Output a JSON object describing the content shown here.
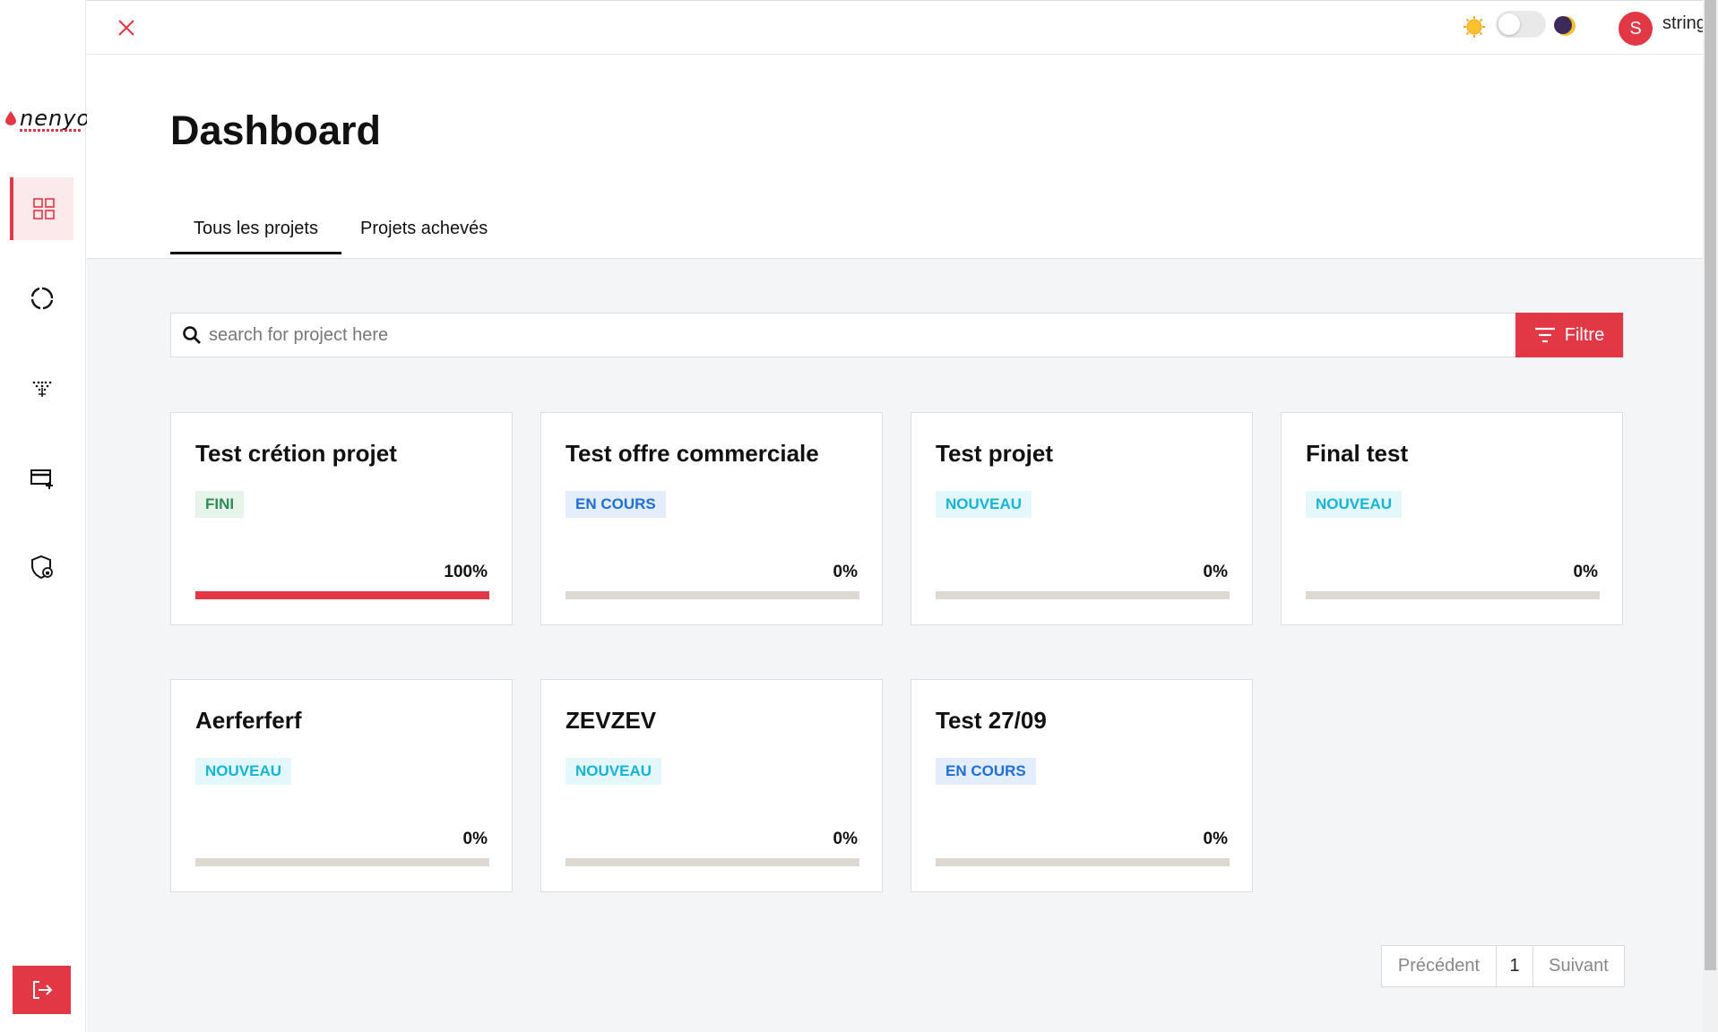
{
  "app": {
    "logo_text": "nenyo"
  },
  "sidebar": {
    "items": [
      {
        "name": "dashboard",
        "icon": "grid-icon",
        "active": true
      },
      {
        "name": "progress",
        "icon": "circle-loader-icon",
        "active": false
      },
      {
        "name": "network",
        "icon": "tree-network-icon",
        "active": false
      },
      {
        "name": "add-card",
        "icon": "card-add-icon",
        "active": false
      },
      {
        "name": "security",
        "icon": "shield-lock-icon",
        "active": false
      }
    ],
    "logout_icon": "logout-icon"
  },
  "topbar": {
    "theme_light_icon": "sun-icon",
    "theme_dark_icon": "moon-icon",
    "user": {
      "initial": "S",
      "name": "string"
    }
  },
  "header": {
    "title": "Dashboard",
    "tabs": [
      {
        "label": "Tous les projets",
        "active": true
      },
      {
        "label": "Projets achevés",
        "active": false
      }
    ]
  },
  "search": {
    "placeholder": "search for project here",
    "filter_label": "Filtre"
  },
  "projects": [
    {
      "title": "Test crétion projet",
      "status": "FINI",
      "progress_label": "100%",
      "progress": 1.0
    },
    {
      "title": "Test offre commerciale",
      "status": "EN COURS",
      "progress_label": "0%",
      "progress": 0
    },
    {
      "title": "Test projet",
      "status": "NOUVEAU",
      "progress_label": "0%",
      "progress": 0
    },
    {
      "title": "Final test",
      "status": "NOUVEAU",
      "progress_label": "0%",
      "progress": 0
    },
    {
      "title": "Aerferferf",
      "status": "NOUVEAU",
      "progress_label": "0%",
      "progress": 0
    },
    {
      "title": "ZEVZEV",
      "status": "NOUVEAU",
      "progress_label": "0%",
      "progress": 0
    },
    {
      "title": "Test 27/09",
      "status": "EN COURS",
      "progress_label": "0%",
      "progress": 0
    }
  ],
  "pagination": {
    "prev": "Précédent",
    "page": "1",
    "next": "Suivant"
  },
  "colors": {
    "accent": "#e23744",
    "fini": "#2e8b57",
    "en_cours": "#1e6fd9",
    "nouveau": "#12b5d8"
  }
}
